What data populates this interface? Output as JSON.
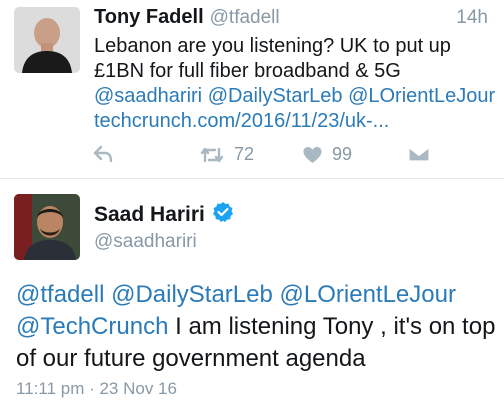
{
  "tweet1": {
    "display_name": "Tony Fadell",
    "handle": "@tfadell",
    "time": "14h",
    "text_plain_1": "Lebanon are you listening? UK to put up £1BN for full fiber broadband & 5G ",
    "mention_1": "@saadhariri",
    "mention_2": "@DailyStarLeb",
    "mention_3": "@LOrientLeJour",
    "link": "techcrunch.com/2016/11/23/uk-...",
    "retweet_count": "72",
    "like_count": "99",
    "icons": [
      "reply-icon",
      "retweet-icon",
      "heart-icon",
      "direct-message-icon"
    ]
  },
  "tweet2": {
    "display_name": "Saad Hariri",
    "handle": "@saadhariri",
    "verified": true,
    "mention_1": "@tfadell",
    "mention_2": "@DailyStarLeb",
    "mention_3": "@LOrientLeJour",
    "mention_4": "@TechCrunch",
    "text_plain": " I am listening Tony , it's on top of our future government agenda",
    "timestamp": "11:11 pm · 23 Nov 16"
  },
  "colors": {
    "link": "#2b7bb9",
    "secondary_text": "#8899a6",
    "icon": "#aab8c2",
    "verified": "#1da1f2"
  }
}
